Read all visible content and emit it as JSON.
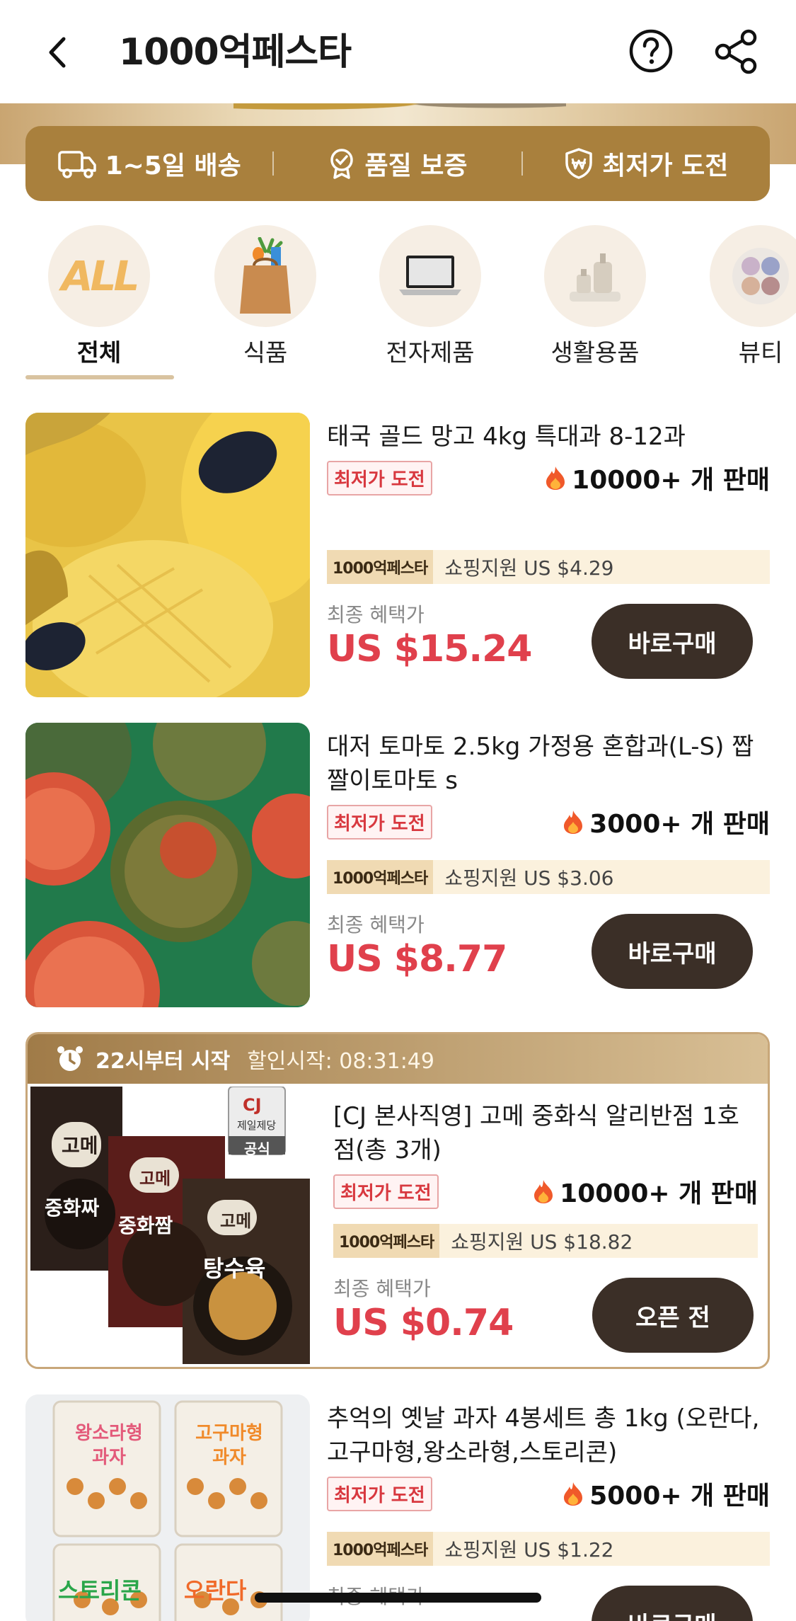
{
  "header": {
    "title": "1000억페스타"
  },
  "benefits": [
    {
      "label": "1~5일 배송",
      "icon": "truck-icon"
    },
    {
      "label": "품질 보증",
      "icon": "quality-badge-icon"
    },
    {
      "label": "최저가 도전",
      "icon": "shield-won-icon"
    }
  ],
  "categories": [
    {
      "label": "전체",
      "icon": "all-icon",
      "icon_text": "ALL",
      "active": true
    },
    {
      "label": "식품",
      "icon": "grocery-bag-icon"
    },
    {
      "label": "전자제품",
      "icon": "laptop-icon"
    },
    {
      "label": "생활용품",
      "icon": "bottles-icon"
    },
    {
      "label": "뷰티",
      "icon": "eyeshadow-palette-icon"
    }
  ],
  "products": [
    {
      "name": "태국 골드 망고 4kg 특대과 8-12과",
      "badge": "최저가 도전",
      "sold": "10000+ 개 판매",
      "support_tag": "1000억페스타",
      "support_text": "쇼핑지원 US $4.29",
      "final_label": "최종 혜택가",
      "price": "US $15.24",
      "button": "바로구매"
    },
    {
      "name": "대저 토마토 2.5kg 가정용 혼합과(L-S) 짭짤이토마토 s",
      "badge": "최저가 도전",
      "sold": "3000+ 개 판매",
      "support_tag": "1000억페스타",
      "support_text": "쇼핑지원 US $3.06",
      "final_label": "최종 혜택가",
      "price": "US $8.77",
      "button": "바로구매"
    },
    {
      "start_label": "22시부터 시작",
      "countdown": "할인시작: 08:31:49",
      "official_brand": "CJ",
      "official_company": "제일제당",
      "official_tag": "공식",
      "name": "[CJ 본사직영] 고메 중화식 알리반점 1호점(총 3개)",
      "badge": "최저가 도전",
      "sold": "10000+ 개 판매",
      "support_tag": "1000억페스타",
      "support_text": "쇼핑지원 US $18.82",
      "final_label": "최종 혜택가",
      "price": "US $0.74",
      "button": "오픈 전",
      "package_texts": [
        "고메",
        "중화짜",
        "고메",
        "중화짬",
        "고메",
        "탕수육"
      ]
    },
    {
      "name": "추억의 옛날 과자 4봉세트 총 1kg (오란다, 고구마형,왕소라형,스토리콘)",
      "badge": "최저가 도전",
      "sold": "5000+ 개 판매",
      "support_tag": "1000억페스타",
      "support_text": "쇼핑지원 US $1.22",
      "final_label": "최종 혜택가",
      "button": "바로구매",
      "package_texts": [
        "왕소라형 과자",
        "고구마형 과자",
        "스토리콘",
        "오란다"
      ]
    }
  ],
  "colors": {
    "gold": "#a9803d",
    "price_red": "#e0404c",
    "button_dark": "#3b2f27"
  }
}
